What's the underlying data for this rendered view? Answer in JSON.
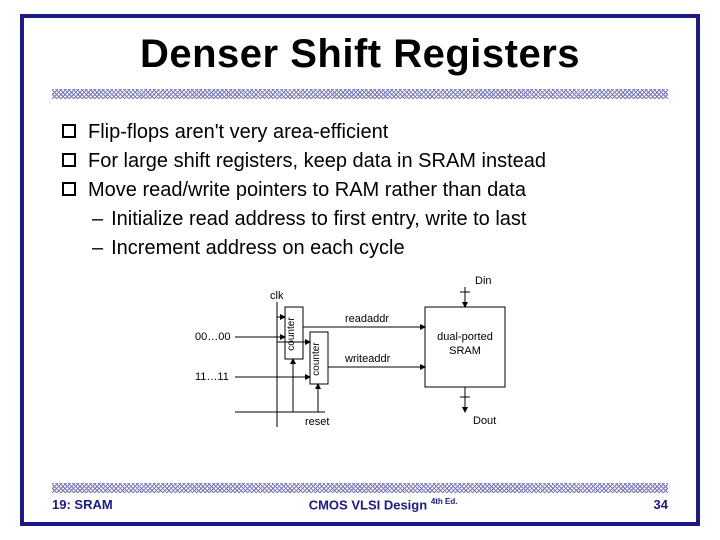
{
  "title": "Denser Shift Registers",
  "bullets": [
    "Flip-flops aren't very area-efficient",
    "For large shift registers, keep data in SRAM instead",
    "Move read/write pointers to RAM rather than data"
  ],
  "subbullets": [
    "Initialize read address to first entry, write to last",
    "Increment address on each cycle"
  ],
  "diagram": {
    "clk": "clk",
    "readaddr": "readaddr",
    "writeaddr": "writeaddr",
    "reset": "reset",
    "din": "Din",
    "dout": "Dout",
    "sram": "dual-ported\nSRAM",
    "counter1": "counter",
    "counter2": "counter",
    "init_read": "00…00",
    "init_write": "11…11"
  },
  "footer": {
    "left": "19: SRAM",
    "center_main": "CMOS VLSI Design",
    "center_sup": "4th Ed.",
    "right": "34"
  }
}
